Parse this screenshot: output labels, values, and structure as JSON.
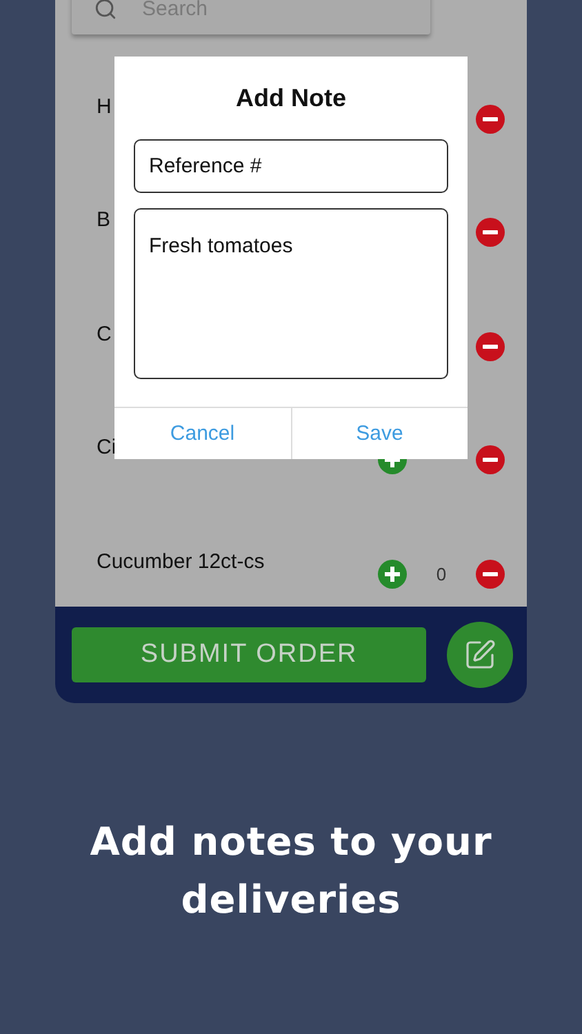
{
  "search": {
    "placeholder": "Search"
  },
  "products": [
    {
      "name": "H",
      "add": false
    },
    {
      "name": "B",
      "add": false
    },
    {
      "name": "C",
      "add": false
    },
    {
      "name": "Ci",
      "add": true
    },
    {
      "name": "Cucumber 12ct-cs",
      "add": true,
      "count": "0"
    }
  ],
  "dialog": {
    "title": "Add Note",
    "reference": {
      "value": "Reference #"
    },
    "note": {
      "value": "Fresh tomatoes"
    },
    "buttons": [
      "Cancel",
      "Save"
    ]
  },
  "submit": "SUBMIT ORDER",
  "caption": "Add notes to your deliveries"
}
